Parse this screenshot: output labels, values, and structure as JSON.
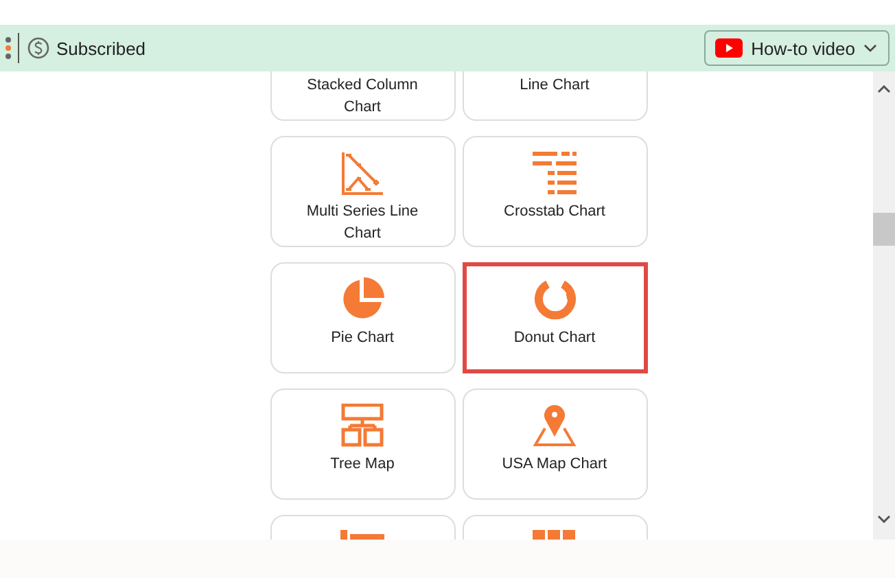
{
  "toolbar": {
    "status": "Subscribed",
    "video_button": "How-to video"
  },
  "charts": [
    {
      "label": "Stacked Column Chart",
      "kind": "stacked",
      "selected": false
    },
    {
      "label": "Line Chart",
      "kind": "line",
      "selected": false
    },
    {
      "label": "Multi Series Line Chart",
      "kind": "multiline",
      "selected": false
    },
    {
      "label": "Crosstab Chart",
      "kind": "crosstab",
      "selected": false
    },
    {
      "label": "Pie Chart",
      "kind": "pie",
      "selected": false
    },
    {
      "label": "Donut Chart",
      "kind": "donut",
      "selected": true
    },
    {
      "label": "Tree Map",
      "kind": "treemap",
      "selected": false
    },
    {
      "label": "USA Map Chart",
      "kind": "map",
      "selected": false
    },
    {
      "kind": "bars",
      "selected": false
    },
    {
      "kind": "grid",
      "selected": false
    }
  ]
}
